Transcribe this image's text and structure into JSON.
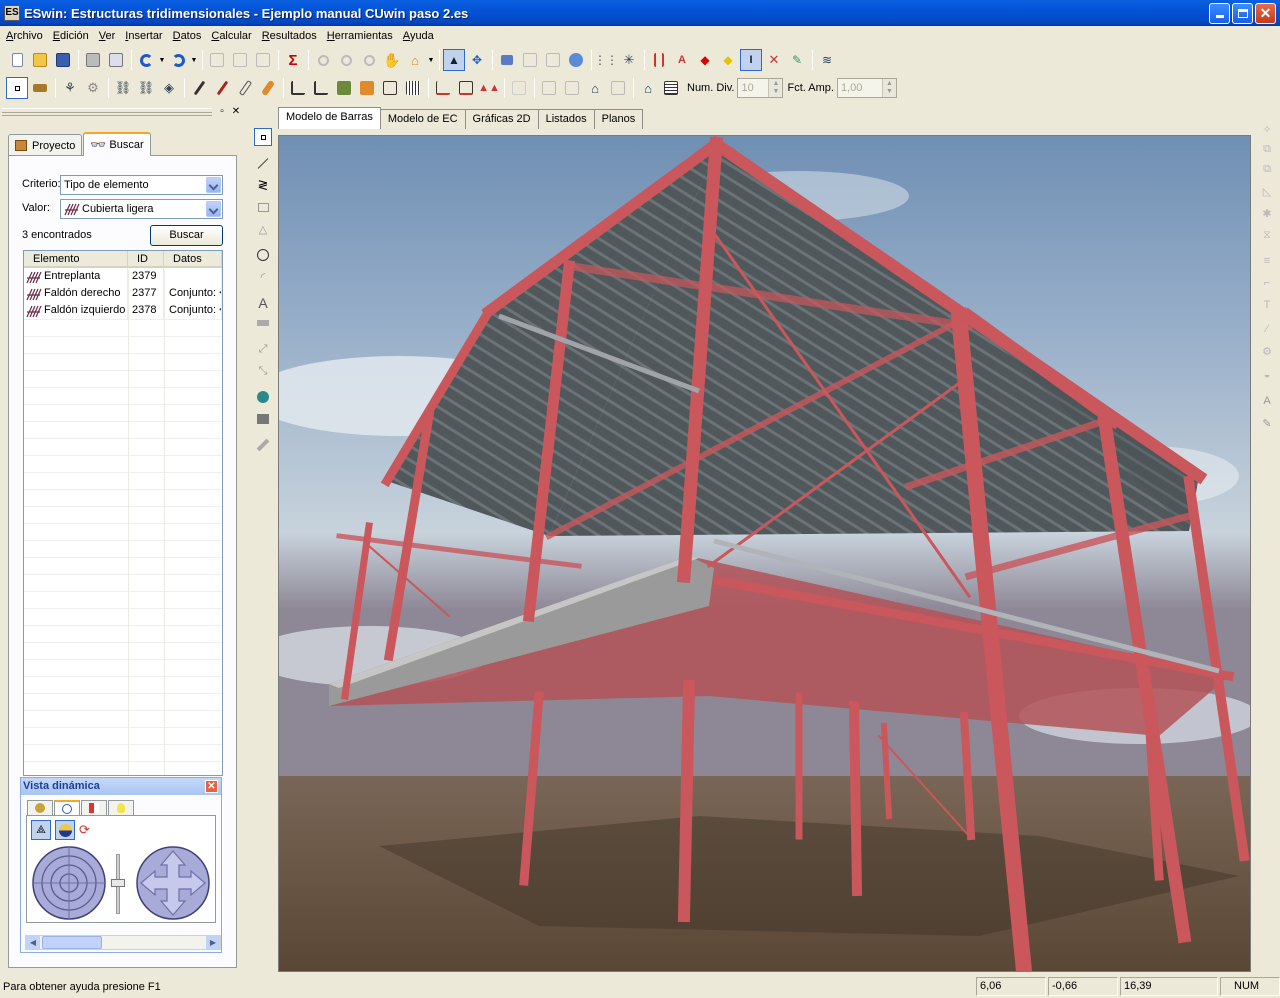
{
  "window": {
    "title": "ESwin: Estructuras tridimensionales - Ejemplo manual CUwin paso 2.es",
    "app_icon": "ES"
  },
  "menu": [
    "Archivo",
    "Edición",
    "Ver",
    "Insertar",
    "Datos",
    "Calcular",
    "Resultados",
    "Herramientas",
    "Ayuda"
  ],
  "toolbar2": {
    "num_div_label": "Num. Div.",
    "num_div_value": "10",
    "fct_amp_label": "Fct. Amp.",
    "fct_amp_value": "1,00"
  },
  "left_panel": {
    "tabs": [
      {
        "label": "Proyecto",
        "icon": "project-icon"
      },
      {
        "label": "Buscar",
        "icon": "binoculars-icon"
      }
    ],
    "active_tab": "Buscar",
    "criterio_label": "Criterio:",
    "criterio_value": "Tipo de elemento",
    "valor_label": "Valor:",
    "valor_value": "Cubierta ligera",
    "found_text": "3 encontrados",
    "search_button": "Buscar",
    "table": {
      "headers": [
        "Elemento",
        "ID",
        "Datos"
      ],
      "rows": [
        {
          "elemento": "Entreplanta",
          "id": "2379",
          "datos": ""
        },
        {
          "elemento": "Faldón derecho",
          "id": "2377",
          "datos": "Conjunto: <"
        },
        {
          "elemento": "Faldón izquierdo",
          "id": "2378",
          "datos": "Conjunto: <"
        }
      ]
    }
  },
  "dynamic_view": {
    "title": "Vista dinámica",
    "close": "✕"
  },
  "doc_tabs": [
    "Modelo de Barras",
    "Modelo de EC",
    "Gráficas 2D",
    "Listados",
    "Planos"
  ],
  "active_doc_tab": "Modelo de Barras",
  "status": {
    "text": "Para obtener ayuda presione F1",
    "x": "6,06",
    "y": "-0,66",
    "z": "16,39",
    "num": "NUM"
  },
  "colors": {
    "steel": "#c9575c",
    "steel_dark": "#8e3a3f",
    "roof": "#555b5e",
    "slab": "#8f8f8f",
    "titlebar": "#0453d6"
  }
}
